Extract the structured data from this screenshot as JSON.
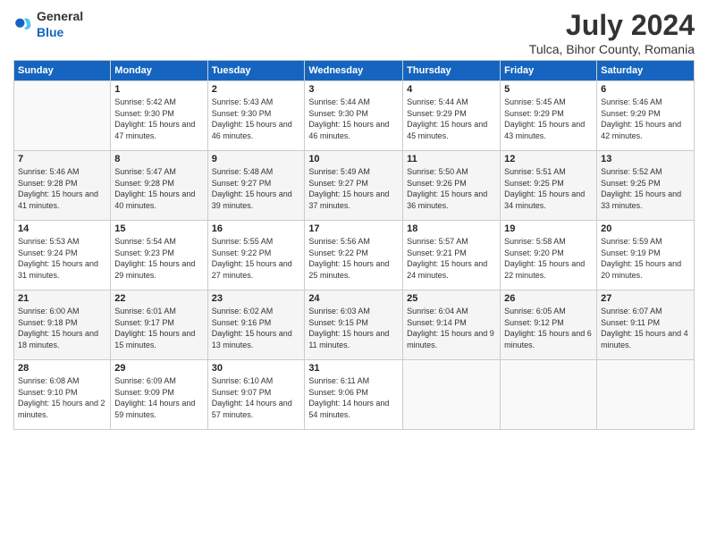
{
  "header": {
    "logo_general": "General",
    "logo_blue": "Blue",
    "month": "July 2024",
    "location": "Tulca, Bihor County, Romania"
  },
  "weekdays": [
    "Sunday",
    "Monday",
    "Tuesday",
    "Wednesday",
    "Thursday",
    "Friday",
    "Saturday"
  ],
  "weeks": [
    [
      {
        "day": "",
        "sunrise": "",
        "sunset": "",
        "daylight": ""
      },
      {
        "day": "1",
        "sunrise": "Sunrise: 5:42 AM",
        "sunset": "Sunset: 9:30 PM",
        "daylight": "Daylight: 15 hours and 47 minutes."
      },
      {
        "day": "2",
        "sunrise": "Sunrise: 5:43 AM",
        "sunset": "Sunset: 9:30 PM",
        "daylight": "Daylight: 15 hours and 46 minutes."
      },
      {
        "day": "3",
        "sunrise": "Sunrise: 5:44 AM",
        "sunset": "Sunset: 9:30 PM",
        "daylight": "Daylight: 15 hours and 46 minutes."
      },
      {
        "day": "4",
        "sunrise": "Sunrise: 5:44 AM",
        "sunset": "Sunset: 9:29 PM",
        "daylight": "Daylight: 15 hours and 45 minutes."
      },
      {
        "day": "5",
        "sunrise": "Sunrise: 5:45 AM",
        "sunset": "Sunset: 9:29 PM",
        "daylight": "Daylight: 15 hours and 43 minutes."
      },
      {
        "day": "6",
        "sunrise": "Sunrise: 5:46 AM",
        "sunset": "Sunset: 9:29 PM",
        "daylight": "Daylight: 15 hours and 42 minutes."
      }
    ],
    [
      {
        "day": "7",
        "sunrise": "Sunrise: 5:46 AM",
        "sunset": "Sunset: 9:28 PM",
        "daylight": "Daylight: 15 hours and 41 minutes."
      },
      {
        "day": "8",
        "sunrise": "Sunrise: 5:47 AM",
        "sunset": "Sunset: 9:28 PM",
        "daylight": "Daylight: 15 hours and 40 minutes."
      },
      {
        "day": "9",
        "sunrise": "Sunrise: 5:48 AM",
        "sunset": "Sunset: 9:27 PM",
        "daylight": "Daylight: 15 hours and 39 minutes."
      },
      {
        "day": "10",
        "sunrise": "Sunrise: 5:49 AM",
        "sunset": "Sunset: 9:27 PM",
        "daylight": "Daylight: 15 hours and 37 minutes."
      },
      {
        "day": "11",
        "sunrise": "Sunrise: 5:50 AM",
        "sunset": "Sunset: 9:26 PM",
        "daylight": "Daylight: 15 hours and 36 minutes."
      },
      {
        "day": "12",
        "sunrise": "Sunrise: 5:51 AM",
        "sunset": "Sunset: 9:25 PM",
        "daylight": "Daylight: 15 hours and 34 minutes."
      },
      {
        "day": "13",
        "sunrise": "Sunrise: 5:52 AM",
        "sunset": "Sunset: 9:25 PM",
        "daylight": "Daylight: 15 hours and 33 minutes."
      }
    ],
    [
      {
        "day": "14",
        "sunrise": "Sunrise: 5:53 AM",
        "sunset": "Sunset: 9:24 PM",
        "daylight": "Daylight: 15 hours and 31 minutes."
      },
      {
        "day": "15",
        "sunrise": "Sunrise: 5:54 AM",
        "sunset": "Sunset: 9:23 PM",
        "daylight": "Daylight: 15 hours and 29 minutes."
      },
      {
        "day": "16",
        "sunrise": "Sunrise: 5:55 AM",
        "sunset": "Sunset: 9:22 PM",
        "daylight": "Daylight: 15 hours and 27 minutes."
      },
      {
        "day": "17",
        "sunrise": "Sunrise: 5:56 AM",
        "sunset": "Sunset: 9:22 PM",
        "daylight": "Daylight: 15 hours and 25 minutes."
      },
      {
        "day": "18",
        "sunrise": "Sunrise: 5:57 AM",
        "sunset": "Sunset: 9:21 PM",
        "daylight": "Daylight: 15 hours and 24 minutes."
      },
      {
        "day": "19",
        "sunrise": "Sunrise: 5:58 AM",
        "sunset": "Sunset: 9:20 PM",
        "daylight": "Daylight: 15 hours and 22 minutes."
      },
      {
        "day": "20",
        "sunrise": "Sunrise: 5:59 AM",
        "sunset": "Sunset: 9:19 PM",
        "daylight": "Daylight: 15 hours and 20 minutes."
      }
    ],
    [
      {
        "day": "21",
        "sunrise": "Sunrise: 6:00 AM",
        "sunset": "Sunset: 9:18 PM",
        "daylight": "Daylight: 15 hours and 18 minutes."
      },
      {
        "day": "22",
        "sunrise": "Sunrise: 6:01 AM",
        "sunset": "Sunset: 9:17 PM",
        "daylight": "Daylight: 15 hours and 15 minutes."
      },
      {
        "day": "23",
        "sunrise": "Sunrise: 6:02 AM",
        "sunset": "Sunset: 9:16 PM",
        "daylight": "Daylight: 15 hours and 13 minutes."
      },
      {
        "day": "24",
        "sunrise": "Sunrise: 6:03 AM",
        "sunset": "Sunset: 9:15 PM",
        "daylight": "Daylight: 15 hours and 11 minutes."
      },
      {
        "day": "25",
        "sunrise": "Sunrise: 6:04 AM",
        "sunset": "Sunset: 9:14 PM",
        "daylight": "Daylight: 15 hours and 9 minutes."
      },
      {
        "day": "26",
        "sunrise": "Sunrise: 6:05 AM",
        "sunset": "Sunset: 9:12 PM",
        "daylight": "Daylight: 15 hours and 6 minutes."
      },
      {
        "day": "27",
        "sunrise": "Sunrise: 6:07 AM",
        "sunset": "Sunset: 9:11 PM",
        "daylight": "Daylight: 15 hours and 4 minutes."
      }
    ],
    [
      {
        "day": "28",
        "sunrise": "Sunrise: 6:08 AM",
        "sunset": "Sunset: 9:10 PM",
        "daylight": "Daylight: 15 hours and 2 minutes."
      },
      {
        "day": "29",
        "sunrise": "Sunrise: 6:09 AM",
        "sunset": "Sunset: 9:09 PM",
        "daylight": "Daylight: 14 hours and 59 minutes."
      },
      {
        "day": "30",
        "sunrise": "Sunrise: 6:10 AM",
        "sunset": "Sunset: 9:07 PM",
        "daylight": "Daylight: 14 hours and 57 minutes."
      },
      {
        "day": "31",
        "sunrise": "Sunrise: 6:11 AM",
        "sunset": "Sunset: 9:06 PM",
        "daylight": "Daylight: 14 hours and 54 minutes."
      },
      {
        "day": "",
        "sunrise": "",
        "sunset": "",
        "daylight": ""
      },
      {
        "day": "",
        "sunrise": "",
        "sunset": "",
        "daylight": ""
      },
      {
        "day": "",
        "sunrise": "",
        "sunset": "",
        "daylight": ""
      }
    ]
  ]
}
